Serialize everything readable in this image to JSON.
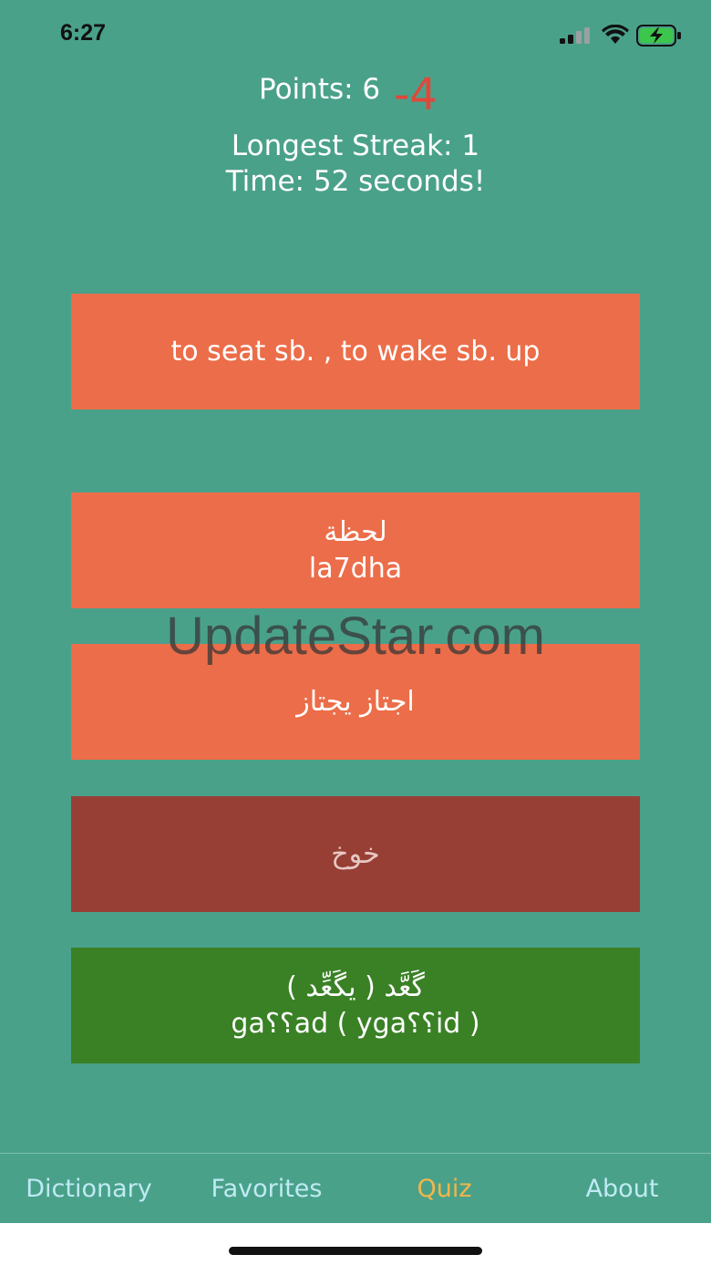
{
  "status_bar": {
    "time": "6:27",
    "icons": [
      "cellular-signal-icon",
      "wifi-icon",
      "battery-charging-icon"
    ]
  },
  "stats": {
    "points_label": "Points: 6",
    "points_delta": "-4",
    "longest_streak": "Longest Streak: 1",
    "time": "Time: 52 seconds!"
  },
  "quiz": {
    "prompt": "to seat sb. ,  to wake sb. up",
    "options": [
      {
        "arabic": "لحظة",
        "translit": "la7dha",
        "state": "normal"
      },
      {
        "arabic": "اجتاز يجتاز",
        "translit": "",
        "state": "normal"
      },
      {
        "arabic": "خوخ",
        "translit": "",
        "state": "wrong"
      },
      {
        "arabic": "گَعَّد  ( يگَعِّد  )",
        "translit": "ga؟؟ad ( yga؟؟id )",
        "state": "correct"
      }
    ]
  },
  "watermark": "UpdateStar.com",
  "tabs": [
    {
      "label": "Dictionary",
      "active": false
    },
    {
      "label": "Favorites",
      "active": false
    },
    {
      "label": "Quiz",
      "active": true
    },
    {
      "label": "About",
      "active": false
    }
  ],
  "colors": {
    "background": "#4aa18a",
    "card": "#ec6d49",
    "wrong": "#983f35",
    "correct": "#3a8126",
    "delta": "#e0483a",
    "tab_inactive": "#bfeaf3",
    "tab_active": "#f2b64a"
  }
}
